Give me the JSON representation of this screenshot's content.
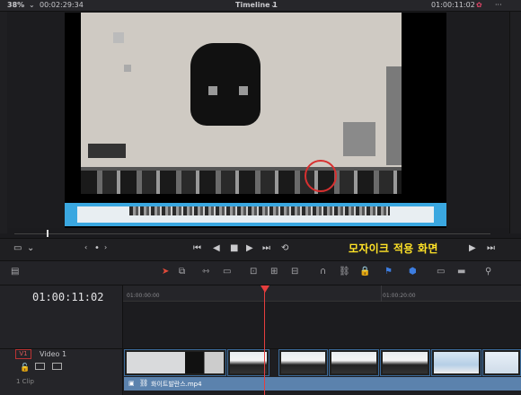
{
  "topbar": {
    "zoom": "38%",
    "source_timecode": "00:02:29:34",
    "timeline_name": "Timeline 1",
    "record_timecode": "01:00:11:02"
  },
  "viewer": {
    "overlay_caption": "모자이크 적용 화면"
  },
  "timeline": {
    "current_timecode": "01:00:11:02",
    "ruler_labels": [
      "01:00:00:00",
      "01:00:20:00"
    ],
    "track": {
      "badge": "V1",
      "name": "Video 1",
      "clip_count_label": "1 Clip"
    },
    "clip_name": "화이트발란스.mp4"
  },
  "icons": [
    "grid-icon",
    "chevron-down-icon",
    "prev-clip-icon",
    "dot-icon",
    "next-clip-icon",
    "skip-start-icon",
    "step-back-icon",
    "stop-icon",
    "play-icon",
    "skip-end-icon",
    "loop-icon",
    "step-forward-icon",
    "last-frame-icon",
    "pointer-icon",
    "trim-icon",
    "blade-icon",
    "snap-icon",
    "link-icon",
    "lock-icon",
    "flag-icon",
    "marker-icon",
    "zoom-icon"
  ],
  "colors": {
    "caption": "#ffe227",
    "playhead": "#e53e3e",
    "clip": "#5b82ad",
    "subtitle_bar": "#3aa7e0"
  }
}
